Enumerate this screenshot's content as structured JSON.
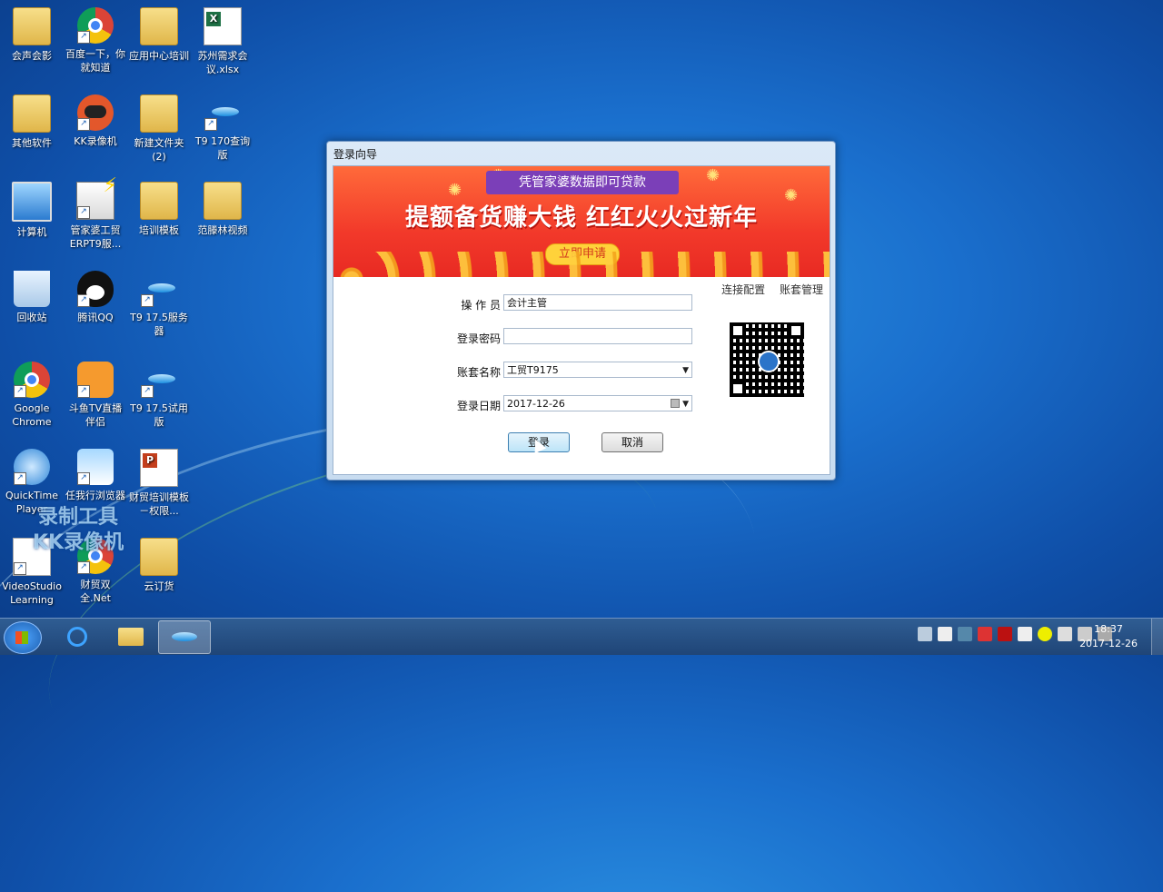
{
  "desktop": {
    "icons": [
      {
        "label": "会声会影"
      },
      {
        "label": "百度一下，你就知道"
      },
      {
        "label": "应用中心培训"
      },
      {
        "label": "苏州需求会议.xlsx"
      },
      {
        "label": "其他软件"
      },
      {
        "label": "KK录像机"
      },
      {
        "label": "新建文件夹 (2)"
      },
      {
        "label": "T9 170查询版"
      },
      {
        "label": "计算机"
      },
      {
        "label": "管家婆工贸ERPT9服..."
      },
      {
        "label": "培训模板"
      },
      {
        "label": "范滕林视频"
      },
      {
        "label": "回收站"
      },
      {
        "label": "腾讯QQ"
      },
      {
        "label": "T9 17.5服务器"
      },
      {
        "label": "Google Chrome"
      },
      {
        "label": "斗鱼TV直播伴侣"
      },
      {
        "label": "T9 17.5试用版"
      },
      {
        "label": "QuickTime Player"
      },
      {
        "label": "任我行浏览器"
      },
      {
        "label": "财贸培训模板－权限..."
      },
      {
        "label": "VideoStudio Learning"
      },
      {
        "label": "财贸双全.Net"
      },
      {
        "label": "云订货"
      }
    ],
    "watermark_line1": "录制工具",
    "watermark_line2": "KK录像机"
  },
  "dialog": {
    "title": "登录向导",
    "banner": {
      "ribbon": "凭管家婆数据即可贷款",
      "headline": "提额备货赚大钱  红红火火过新年",
      "apply_button": "立即申请"
    },
    "links": {
      "connect": "连接配置",
      "account": "账套管理"
    },
    "form": {
      "operator_label": "操 作 员",
      "operator_value": "会计主管",
      "password_label": "登录密码",
      "password_value": "",
      "account_label": "账套名称",
      "account_value": "工贸T9175",
      "date_label": "登录日期",
      "date_value": "2017-12-26"
    },
    "buttons": {
      "login": "登录",
      "cancel": "取消"
    }
  },
  "taskbar": {
    "time": "18:37",
    "date": "2017-12-26"
  }
}
